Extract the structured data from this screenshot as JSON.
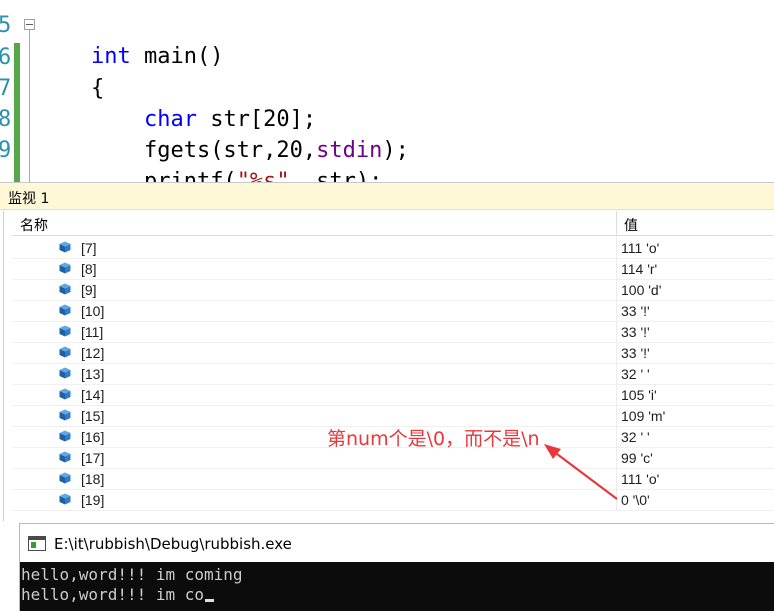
{
  "editor": {
    "line_numbers": [
      "5",
      "6",
      "7",
      "8",
      "9"
    ],
    "lines": [
      {
        "parts": [
          {
            "t": "int",
            "c": "kw"
          },
          {
            "t": " main()",
            "c": ""
          }
        ]
      },
      {
        "parts": [
          {
            "t": "{",
            "c": ""
          }
        ]
      },
      {
        "parts": [
          {
            "t": "    ",
            "c": ""
          },
          {
            "t": "char",
            "c": "kw"
          },
          {
            "t": " str[20];",
            "c": ""
          }
        ]
      },
      {
        "parts": [
          {
            "t": "    fgets(str,20,",
            "c": ""
          },
          {
            "t": "stdin",
            "c": "mac"
          },
          {
            "t": ");",
            "c": ""
          }
        ]
      },
      {
        "parts": [
          {
            "t": "    printf(",
            "c": ""
          },
          {
            "t": "\"%s\"",
            "c": "str"
          },
          {
            "t": ", str);",
            "c": ""
          }
        ]
      }
    ]
  },
  "watch": {
    "title": "监视 1",
    "col_name": "名称",
    "col_value": "值",
    "rows": [
      {
        "name": "[7]",
        "value": "111 'o'"
      },
      {
        "name": "[8]",
        "value": "114 'r'"
      },
      {
        "name": "[9]",
        "value": "100 'd'"
      },
      {
        "name": "[10]",
        "value": "33 '!'"
      },
      {
        "name": "[11]",
        "value": "33 '!'"
      },
      {
        "name": "[12]",
        "value": "33 '!'"
      },
      {
        "name": "[13]",
        "value": "32 ' '"
      },
      {
        "name": "[14]",
        "value": "105 'i'"
      },
      {
        "name": "[15]",
        "value": "109 'm'"
      },
      {
        "name": "[16]",
        "value": "32 ' '"
      },
      {
        "name": "[17]",
        "value": "99 'c'"
      },
      {
        "name": "[18]",
        "value": "111 'o'"
      },
      {
        "name": "[19]",
        "value": "0 '\\0'"
      }
    ],
    "icon": "variable-cube-icon"
  },
  "annotation": {
    "text": "第num个是\\0，而不是\\n",
    "color": "#e8383d"
  },
  "console": {
    "title": "E:\\it\\rubbish\\Debug\\rubbish.exe",
    "lines": [
      "hello,word!!! im coming",
      "hello,word!!! im co"
    ]
  },
  "colors": {
    "keyword": "#0000ff",
    "macro": "#6f008a",
    "string": "#a31515",
    "line_number": "#2b91af",
    "change_bar": "#57a64a",
    "watch_title_bg": "#fff8d6",
    "console_bg": "#0c0c0c"
  }
}
